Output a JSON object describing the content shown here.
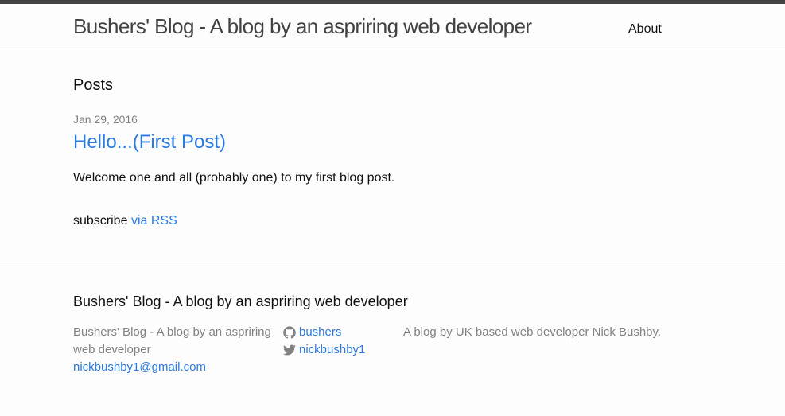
{
  "header": {
    "title": "Bushers' Blog - A blog by an aspriring web developer",
    "nav": {
      "about_label": "About"
    }
  },
  "main": {
    "heading": "Posts",
    "posts": [
      {
        "date": "Jan 29, 2016",
        "title": "Hello...(First Post)",
        "excerpt": "Welcome one and all (probably one) to my first blog post."
      }
    ],
    "rss": {
      "prefix": "subscribe",
      "link_label": "via RSS"
    }
  },
  "footer": {
    "heading": "Bushers' Blog - A blog by an aspriring web developer",
    "site_name": "Bushers' Blog - A blog by an aspriring web developer",
    "email": "nickbushby1@gmail.com",
    "github": {
      "icon": "github-icon",
      "username": "bushers"
    },
    "twitter": {
      "icon": "twitter-icon",
      "username": "nickbushby1"
    },
    "description": "A blog by UK based web developer Nick Bushby."
  },
  "colors": {
    "link": "#2a7ae2",
    "muted": "#828282",
    "topbar": "#424242",
    "border": "#e8e8e8"
  }
}
